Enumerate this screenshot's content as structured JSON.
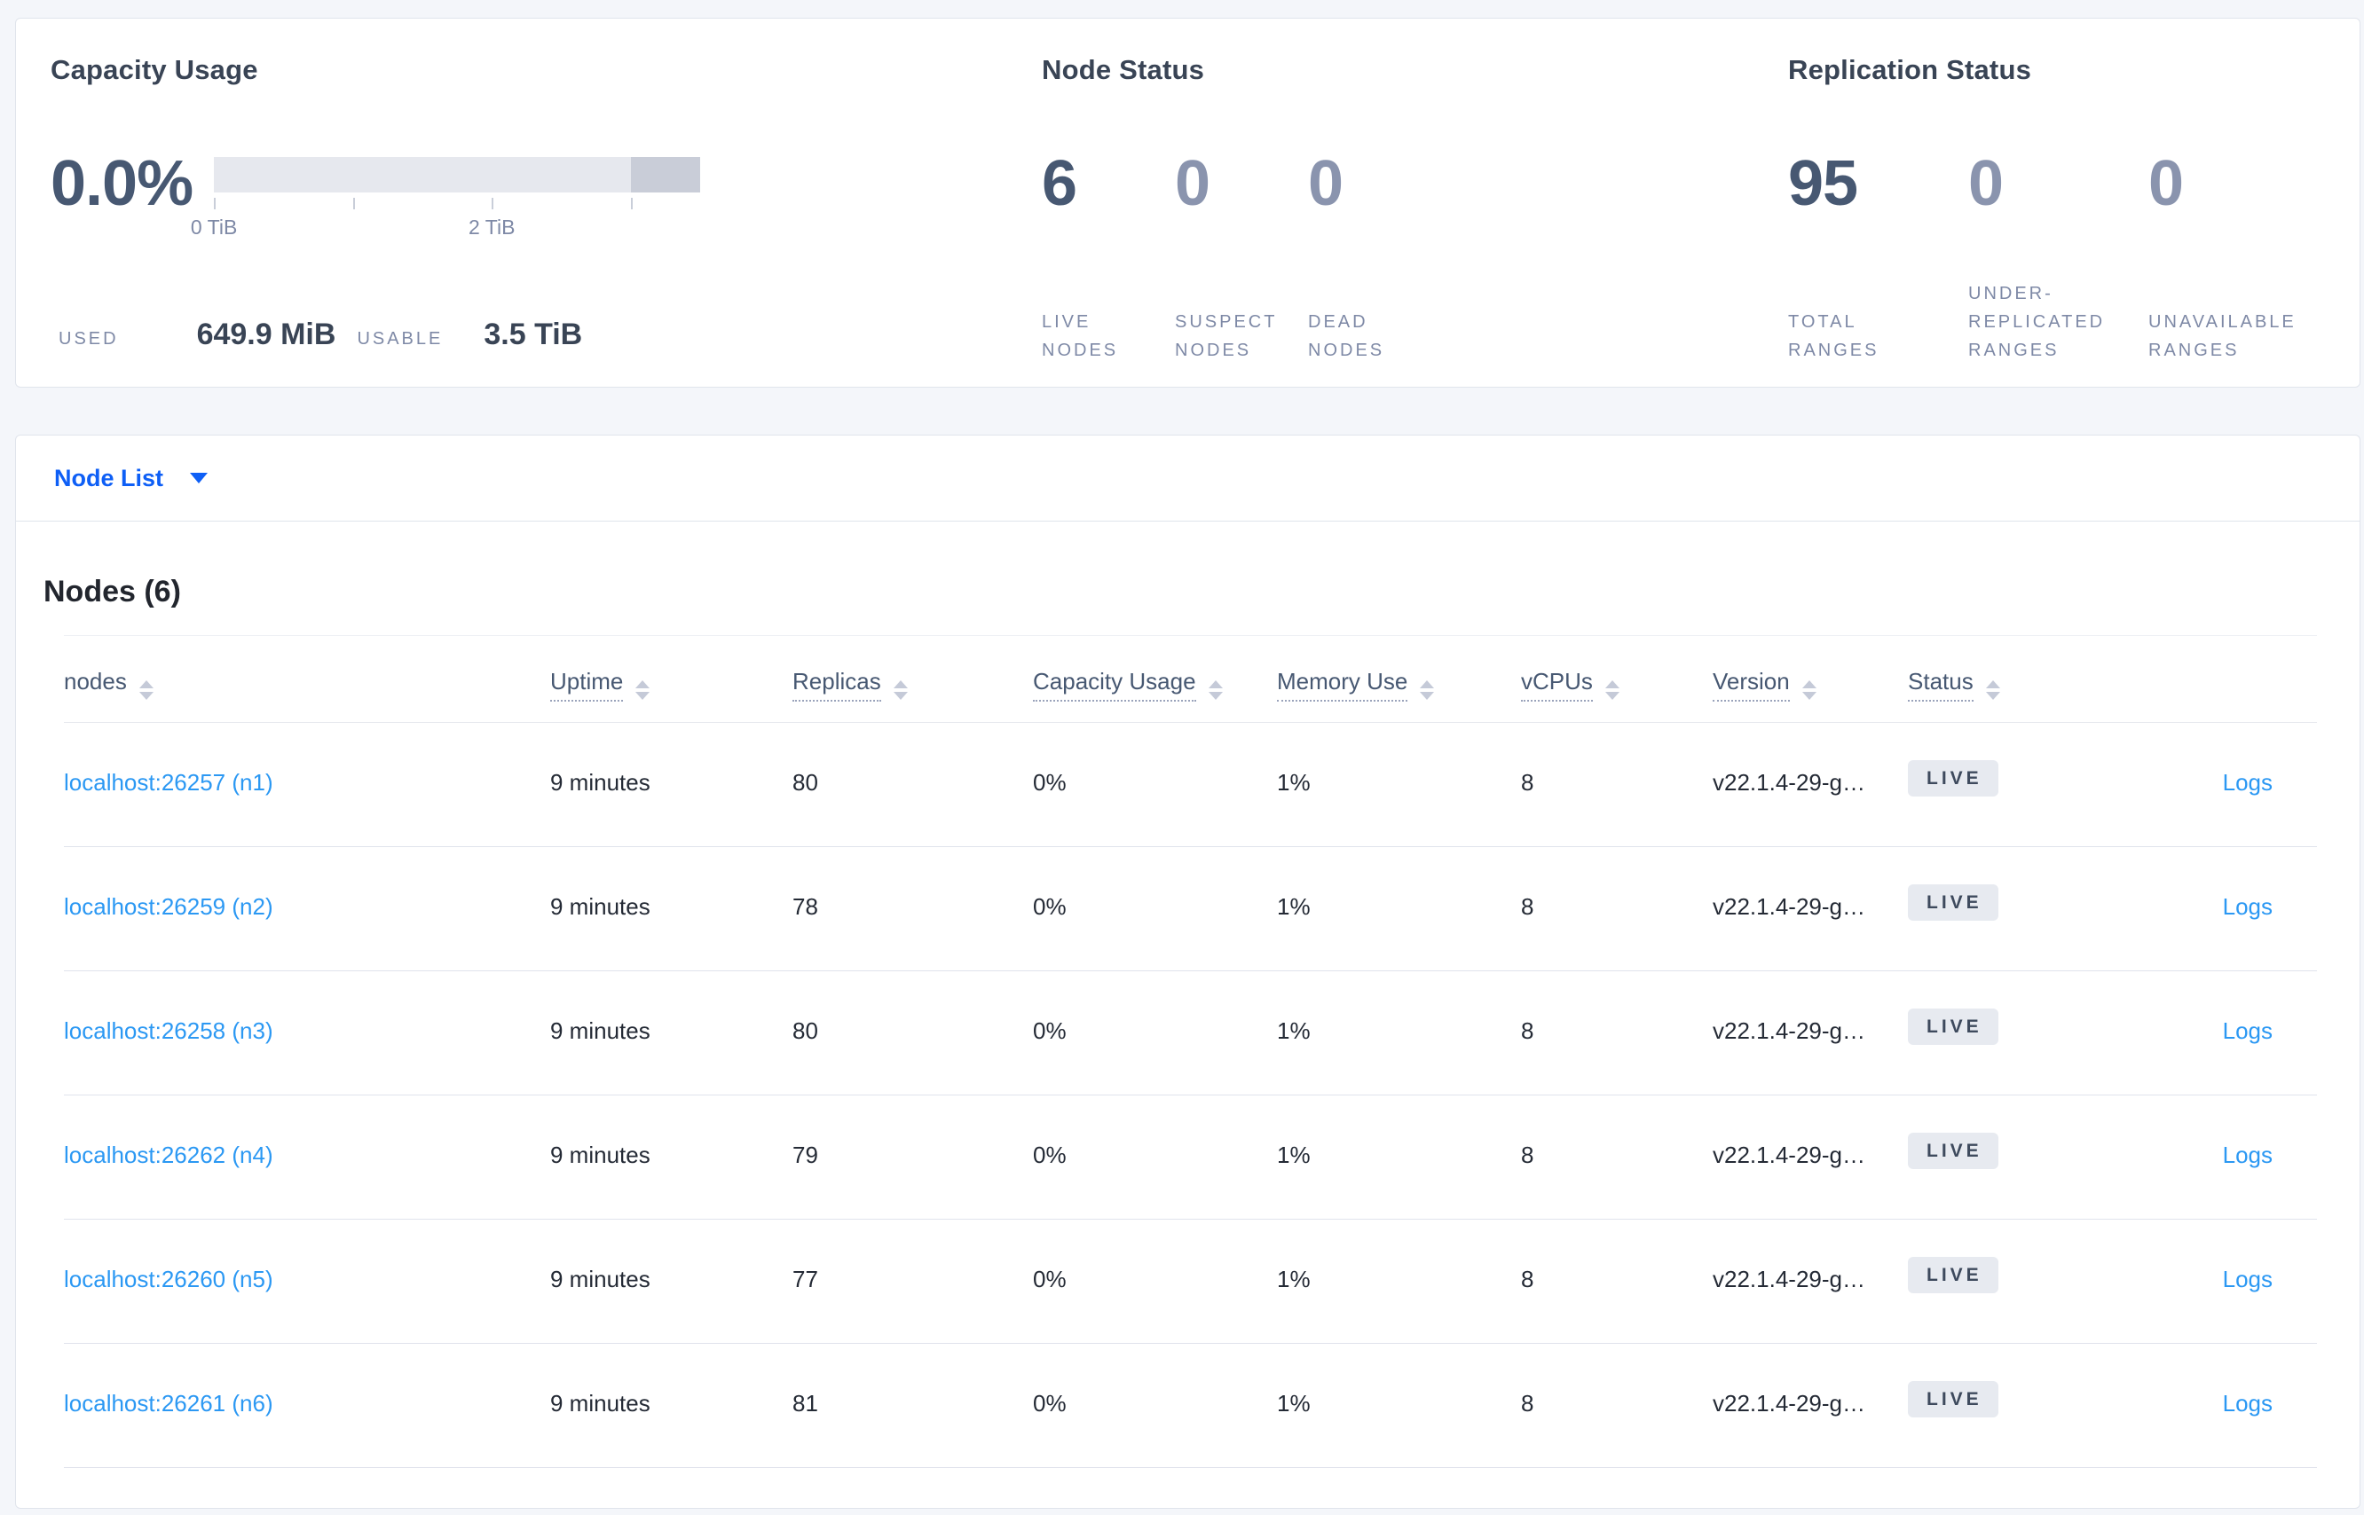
{
  "colors": {
    "page-bg": "#f4f6fa",
    "card-bg": "#ffffff",
    "card-border": "#e0e4ec",
    "title": "#394455",
    "num-dark": "#475872",
    "num-muted": "#8a94ae",
    "label": "#7e89a6",
    "text": "#242a35",
    "link-blue": "#2b98f3",
    "accent-blue": "#0e5ff6",
    "header-text": "#475872",
    "dotted": "#9aa3bb",
    "sort": "#c5cad8",
    "row-border": "#e0e3ec",
    "bar-light": "#e6e8ee",
    "bar-dark": "#c9cdd8",
    "badge-bg": "#e7eaf0",
    "badge-text": "#3e4a5d",
    "tick": "#c9ced9"
  },
  "capacity": {
    "title": "Capacity Usage",
    "percent": "0.0%",
    "bar": {
      "reserved_pct": 14.3,
      "ticks": [
        {
          "pct": 0,
          "label": "0 TiB"
        },
        {
          "pct": 28.57
        },
        {
          "pct": 57.14,
          "label": "2 TiB"
        },
        {
          "pct": 85.71
        }
      ]
    },
    "used_label": "USED",
    "used_value": "649.9 MiB",
    "usable_label": "USABLE",
    "usable_value": "3.5 TiB"
  },
  "node_status": {
    "title": "Node Status",
    "stats": [
      {
        "value": "6",
        "label": "LIVE NODES",
        "muted": false
      },
      {
        "value": "0",
        "label": "SUSPECT NODES",
        "muted": true
      },
      {
        "value": "0",
        "label": "DEAD NODES",
        "muted": true
      }
    ]
  },
  "replication_status": {
    "title": "Replication Status",
    "stats": [
      {
        "value": "95",
        "label": "TOTAL RANGES",
        "muted": false
      },
      {
        "value": "0",
        "label": "UNDER-REPLICATED RANGES",
        "muted": true
      },
      {
        "value": "0",
        "label": "UNAVAILABLE RANGES",
        "muted": true
      }
    ]
  },
  "node_list": {
    "selector_label": "Node List",
    "heading": "Nodes (6)",
    "columns": [
      {
        "label": "nodes",
        "underline": false
      },
      {
        "label": "Uptime",
        "underline": true
      },
      {
        "label": "Replicas",
        "underline": true
      },
      {
        "label": "Capacity Usage",
        "underline": true
      },
      {
        "label": "Memory Use",
        "underline": true
      },
      {
        "label": "vCPUs",
        "underline": true
      },
      {
        "label": "Version",
        "underline": true
      },
      {
        "label": "Status",
        "underline": true
      }
    ],
    "rows": [
      {
        "address": "localhost:26257 (n1)",
        "uptime": "9 minutes",
        "replicas": "80",
        "capacity_usage": "0%",
        "memory_use": "1%",
        "vcpus": "8",
        "version": "v22.1.4-29-g…",
        "status": "LIVE",
        "logs": "Logs"
      },
      {
        "address": "localhost:26259 (n2)",
        "uptime": "9 minutes",
        "replicas": "78",
        "capacity_usage": "0%",
        "memory_use": "1%",
        "vcpus": "8",
        "version": "v22.1.4-29-g…",
        "status": "LIVE",
        "logs": "Logs"
      },
      {
        "address": "localhost:26258 (n3)",
        "uptime": "9 minutes",
        "replicas": "80",
        "capacity_usage": "0%",
        "memory_use": "1%",
        "vcpus": "8",
        "version": "v22.1.4-29-g…",
        "status": "LIVE",
        "logs": "Logs"
      },
      {
        "address": "localhost:26262 (n4)",
        "uptime": "9 minutes",
        "replicas": "79",
        "capacity_usage": "0%",
        "memory_use": "1%",
        "vcpus": "8",
        "version": "v22.1.4-29-g…",
        "status": "LIVE",
        "logs": "Logs"
      },
      {
        "address": "localhost:26260 (n5)",
        "uptime": "9 minutes",
        "replicas": "77",
        "capacity_usage": "0%",
        "memory_use": "1%",
        "vcpus": "8",
        "version": "v22.1.4-29-g…",
        "status": "LIVE",
        "logs": "Logs"
      },
      {
        "address": "localhost:26261 (n6)",
        "uptime": "9 minutes",
        "replicas": "81",
        "capacity_usage": "0%",
        "memory_use": "1%",
        "vcpus": "8",
        "version": "v22.1.4-29-g…",
        "status": "LIVE",
        "logs": "Logs"
      }
    ]
  }
}
